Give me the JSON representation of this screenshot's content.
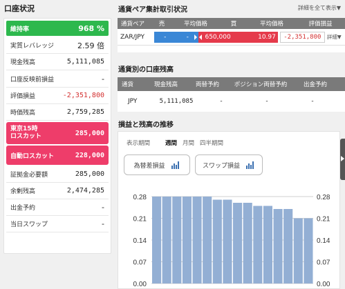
{
  "left": {
    "title": "口座状況",
    "rows": [
      {
        "label": "維持率",
        "value": "968 %",
        "style": "green"
      },
      {
        "label": "実質レバレッジ",
        "value": "2.59 倍",
        "style": "normal"
      },
      {
        "label": "現金残高",
        "value": "5,111,085",
        "style": "normal"
      },
      {
        "label": "口座反映前損益",
        "value": "-",
        "style": "normal"
      },
      {
        "label": "評価損益",
        "value": "-2,351,800",
        "style": "neg"
      },
      {
        "label": "時価残高",
        "value": "2,759,285",
        "style": "normal"
      },
      {
        "label": "東京15時\nロスカット",
        "value": "285,000",
        "style": "pink"
      },
      {
        "label": "自動ロスカット",
        "value": "228,000",
        "style": "pink"
      },
      {
        "label": "証拠金必要額",
        "value": "285,000",
        "style": "normal"
      },
      {
        "label": "余剰残高",
        "value": "2,474,285",
        "style": "normal"
      },
      {
        "label": "出金予約",
        "value": "-",
        "style": "normal"
      },
      {
        "label": "当日スワップ",
        "value": "-",
        "style": "normal"
      }
    ]
  },
  "pair_section": {
    "title": "通貨ペア集計取引状況",
    "expand_all": "詳細を全て表示▼",
    "headers": [
      "通貨ペア",
      "売",
      "平均価格",
      "買",
      "平均価格",
      "評価損益"
    ],
    "row": {
      "pair": "ZAR/JPY",
      "sell_qty": "-",
      "sell_avg": "-",
      "buy_qty": "650,000",
      "buy_avg": "10.97",
      "pl": "-2,351,800",
      "detail": "詳細▼"
    }
  },
  "balance_section": {
    "title": "通貨別の口座残高",
    "headers": [
      "通貨",
      "現金残高",
      "両替予約",
      "ポジション両替予約",
      "出金予約"
    ],
    "row": {
      "currency": "JPY",
      "cash": "5,111,085",
      "exchange_reserve": "-",
      "position_exchange": "-",
      "withdraw": "-"
    }
  },
  "trend_section": {
    "title": "損益と残高の推移",
    "period_label": "表示期間",
    "periods": [
      "週間",
      "月間",
      "四半期間"
    ],
    "active_period": "週間",
    "buttons": [
      "為替差損益",
      "スワップ損益"
    ]
  },
  "colors": {
    "green": "#2db84d",
    "pink": "#ee3d6a",
    "blue": "#3a87d6",
    "red": "#e53a4b",
    "bar": "#93afd4"
  },
  "chart_data": {
    "type": "bar",
    "y_ticks": [
      "0.28",
      "0.21",
      "0.14",
      "0.07",
      "0.00"
    ],
    "ylim": [
      0,
      0.28
    ],
    "values": [
      0.28,
      0.28,
      0.28,
      0.28,
      0.28,
      0.28,
      0.27,
      0.27,
      0.26,
      0.26,
      0.25,
      0.25,
      0.24,
      0.24,
      0.21,
      0.21
    ],
    "grid": true
  }
}
